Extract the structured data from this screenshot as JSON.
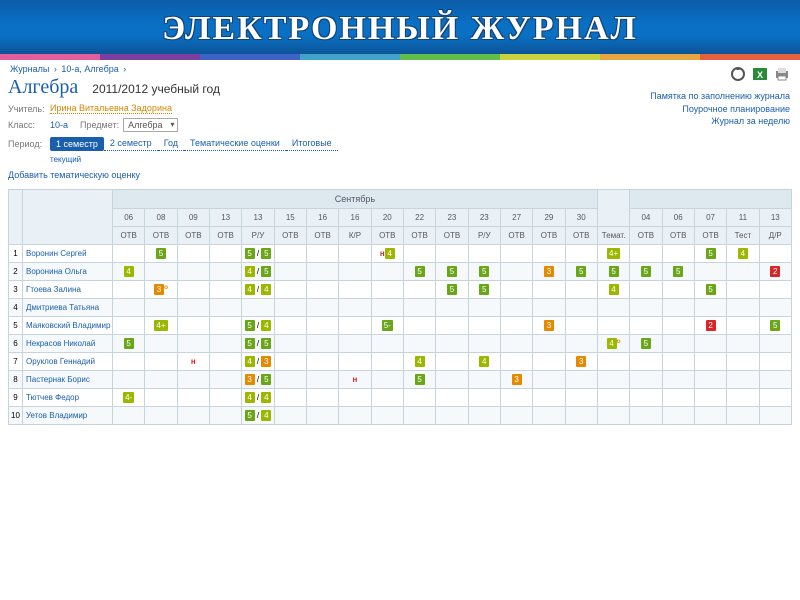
{
  "banner_title": "ЭЛЕКТРОННЫЙ ЖУРНАЛ",
  "rainbow": [
    "#e55e9c",
    "#7a3fa0",
    "#3f62c7",
    "#3fa4c7",
    "#5fbf4a",
    "#c9d23f",
    "#e5a63f",
    "#e5603f"
  ],
  "breadcrumb": [
    "Журналы",
    "10-а, Алгебра"
  ],
  "subject": "Алгебра",
  "year_label": "2011/2012 учебный год",
  "meta": {
    "teacher_lbl": "Учитель:",
    "teacher": "Ирина Витальевна Задорина",
    "class_lbl": "Класс:",
    "class": "10-а",
    "subject_lbl": "Предмет:",
    "subject_sel": "Алгебра",
    "period_lbl": "Период:"
  },
  "period_tabs": [
    "1 семестр",
    "2 семестр",
    "Год",
    "Тематические оценки",
    "Итоговые"
  ],
  "subtab": "текущий",
  "add_link": "Добавить тематическую оценку",
  "right_links": [
    "Памятка по заполнению журнала",
    "Поурочное планирование",
    "Журнал за неделю"
  ],
  "month": "Сентябрь",
  "columns": [
    {
      "d": "06",
      "t": "ОТВ"
    },
    {
      "d": "08",
      "t": "ОТВ"
    },
    {
      "d": "09",
      "t": "ОТВ"
    },
    {
      "d": "13",
      "t": "ОТВ"
    },
    {
      "d": "13",
      "t": "Р/У"
    },
    {
      "d": "15",
      "t": "ОТВ"
    },
    {
      "d": "16",
      "t": "ОТВ"
    },
    {
      "d": "16",
      "t": "К/Р"
    },
    {
      "d": "20",
      "t": "ОТВ"
    },
    {
      "d": "22",
      "t": "ОТВ"
    },
    {
      "d": "23",
      "t": "ОТВ"
    },
    {
      "d": "23",
      "t": "Р/У"
    },
    {
      "d": "27",
      "t": "ОТВ"
    },
    {
      "d": "29",
      "t": "ОТВ"
    },
    {
      "d": "30",
      "t": "ОТВ"
    },
    {
      "d": "Темат.",
      "t": ""
    },
    {
      "d": "04",
      "t": "ОТВ"
    },
    {
      "d": "06",
      "t": "ОТВ"
    },
    {
      "d": "07",
      "t": "ОТВ"
    },
    {
      "d": "11",
      "t": "Тест"
    },
    {
      "d": "13",
      "t": "Д/Р"
    }
  ],
  "students": [
    {
      "n": 1,
      "name": "Воронин Сергей",
      "cells": [
        "",
        "5",
        "",
        "",
        "5/5",
        "",
        "",
        "",
        "н4",
        "",
        "",
        "",
        "",
        "",
        "",
        "4+",
        "",
        "",
        "5",
        "4",
        ""
      ]
    },
    {
      "n": 2,
      "name": "Воронина Ольга",
      "cells": [
        "4",
        "",
        "",
        "",
        "4/5",
        "",
        "",
        "",
        "",
        "5",
        "5",
        "5",
        "",
        "3",
        "5",
        "5",
        "5",
        "5",
        "",
        "",
        "2"
      ]
    },
    {
      "n": 3,
      "name": "Гтоева Залина",
      "cells": [
        "",
        "3о",
        "",
        "",
        "4/4",
        "",
        "",
        "",
        "",
        "",
        "5",
        "5",
        "",
        "",
        "",
        "4",
        "",
        "",
        "5",
        "",
        ""
      ]
    },
    {
      "n": 4,
      "name": "Дмитриева Татьяна",
      "cells": [
        "",
        "",
        "",
        "",
        "",
        "",
        "",
        "",
        "",
        "",
        "",
        "",
        "",
        "",
        "",
        "",
        "",
        "",
        "",
        "",
        ""
      ]
    },
    {
      "n": 5,
      "name": "Маяковский Владимир",
      "cells": [
        "",
        "4+",
        "",
        "",
        "5/4",
        "",
        "",
        "",
        "5-",
        "",
        "",
        "",
        "",
        "3",
        "",
        "",
        "",
        "",
        "2",
        "",
        "5"
      ]
    },
    {
      "n": 6,
      "name": "Некрасов Николай",
      "cells": [
        "5",
        "",
        "",
        "",
        "5/5",
        "",
        "",
        "",
        "",
        "",
        "",
        "",
        "",
        "",
        "",
        "4о",
        "5",
        "",
        "",
        "",
        ""
      ]
    },
    {
      "n": 7,
      "name": "Оруклов Геннадий",
      "cells": [
        "",
        "",
        "н",
        "",
        "4/3",
        "",
        "",
        "",
        "",
        "4",
        "",
        "4",
        "",
        "",
        "3",
        "",
        "",
        "",
        "",
        "",
        ""
      ]
    },
    {
      "n": 8,
      "name": "Пастернак Борис",
      "cells": [
        "",
        "",
        "",
        "",
        "3/5",
        "",
        "",
        "н",
        "",
        "5",
        "",
        "",
        "3",
        "",
        "",
        "",
        "",
        "",
        "",
        "",
        ""
      ]
    },
    {
      "n": 9,
      "name": "Тютчев Федор",
      "cells": [
        "4-",
        "",
        "",
        "",
        "4/4",
        "",
        "",
        "",
        "",
        "",
        "",
        "",
        "",
        "",
        "",
        "",
        "",
        "",
        "",
        "",
        ""
      ]
    },
    {
      "n": 10,
      "name": "Уетов Владимир",
      "cells": [
        "",
        "",
        "",
        "",
        "5/4",
        "",
        "",
        "",
        "",
        "",
        "",
        "",
        "",
        "",
        "",
        "",
        "",
        "",
        "",
        "",
        ""
      ]
    }
  ]
}
